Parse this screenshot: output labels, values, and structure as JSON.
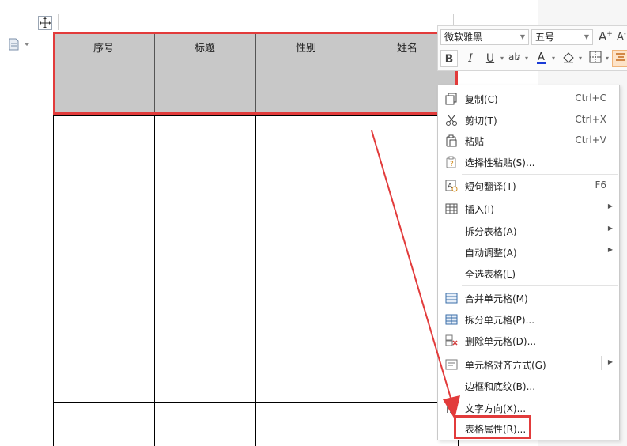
{
  "table": {
    "headers": [
      "序号",
      "标题",
      "性别",
      "姓名"
    ]
  },
  "mini_toolbar": {
    "font_name": "微软雅黑",
    "font_size": "五号",
    "buttons": [
      "B",
      "I",
      "U"
    ]
  },
  "context_menu": {
    "items": [
      {
        "label": "复制(C)",
        "shortcut": "Ctrl+C",
        "icon": "copy-icon"
      },
      {
        "label": "剪切(T)",
        "shortcut": "Ctrl+X",
        "icon": "scissors-icon"
      },
      {
        "label": "粘贴",
        "shortcut": "Ctrl+V",
        "icon": "paste-icon"
      },
      {
        "label": "选择性粘贴(S)...",
        "shortcut": "",
        "icon": "paste-special-icon"
      },
      {
        "label": "短句翻译(T)",
        "shortcut": "F6",
        "icon": "translate-icon"
      },
      {
        "label": "插入(I)",
        "shortcut": "",
        "icon": "table-insert-icon"
      },
      {
        "label": "拆分表格(A)",
        "shortcut": "",
        "icon": ""
      },
      {
        "label": "自动调整(A)",
        "shortcut": "",
        "icon": ""
      },
      {
        "label": "全选表格(L)",
        "shortcut": "",
        "icon": ""
      },
      {
        "label": "合并单元格(M)",
        "shortcut": "",
        "icon": "merge-cells-icon"
      },
      {
        "label": "拆分单元格(P)...",
        "shortcut": "",
        "icon": "split-cells-icon"
      },
      {
        "label": "删除单元格(D)...",
        "shortcut": "",
        "icon": "delete-cells-icon"
      },
      {
        "label": "单元格对齐方式(G)",
        "shortcut": "",
        "icon": "cell-align-icon"
      },
      {
        "label": "边框和底纹(B)...",
        "shortcut": "",
        "icon": ""
      },
      {
        "label": "文字方向(X)...",
        "shortcut": "",
        "icon": "text-direction-icon"
      },
      {
        "label": "表格属性(R)...",
        "shortcut": "",
        "icon": ""
      }
    ]
  },
  "colors": {
    "highlight_red": "#e23b3b",
    "header_gray": "#c8c8c8"
  }
}
